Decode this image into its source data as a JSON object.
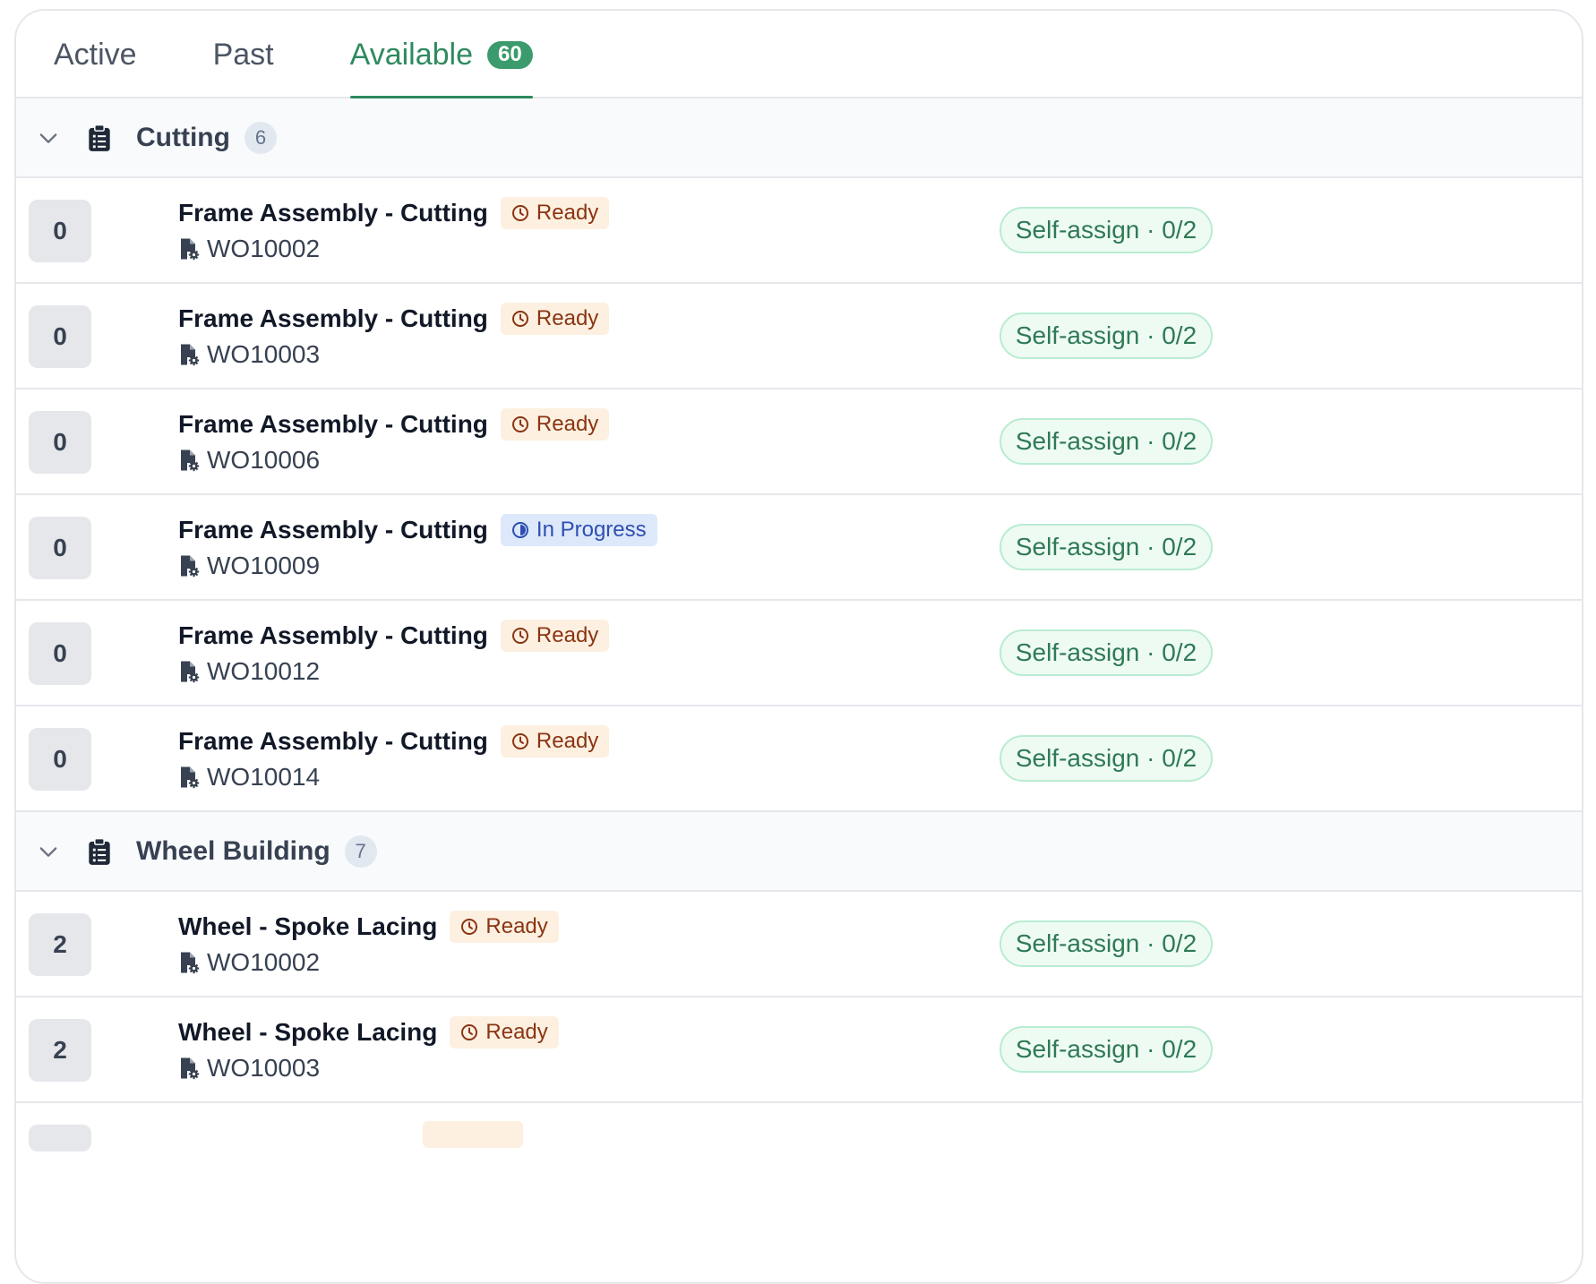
{
  "tabs": [
    {
      "label": "Active"
    },
    {
      "label": "Past"
    },
    {
      "label": "Available",
      "count": "60"
    }
  ],
  "groups": [
    {
      "name": "Cutting",
      "count": "6",
      "rows": [
        {
          "qty": "0",
          "title": "Frame Assembly - Cutting",
          "status": "Ready",
          "wo": "WO10002",
          "action": "Self-assign · 0/2"
        },
        {
          "qty": "0",
          "title": "Frame Assembly - Cutting",
          "status": "Ready",
          "wo": "WO10003",
          "action": "Self-assign · 0/2"
        },
        {
          "qty": "0",
          "title": "Frame Assembly - Cutting",
          "status": "Ready",
          "wo": "WO10006",
          "action": "Self-assign · 0/2"
        },
        {
          "qty": "0",
          "title": "Frame Assembly - Cutting",
          "status": "In Progress",
          "wo": "WO10009",
          "action": "Self-assign · 0/2"
        },
        {
          "qty": "0",
          "title": "Frame Assembly - Cutting",
          "status": "Ready",
          "wo": "WO10012",
          "action": "Self-assign · 0/2"
        },
        {
          "qty": "0",
          "title": "Frame Assembly - Cutting",
          "status": "Ready",
          "wo": "WO10014",
          "action": "Self-assign · 0/2"
        }
      ]
    },
    {
      "name": "Wheel Building",
      "count": "7",
      "rows": [
        {
          "qty": "2",
          "title": "Wheel - Spoke Lacing",
          "status": "Ready",
          "wo": "WO10002",
          "action": "Self-assign · 0/2"
        },
        {
          "qty": "2",
          "title": "Wheel - Spoke Lacing",
          "status": "Ready",
          "wo": "WO10003",
          "action": "Self-assign · 0/2"
        }
      ]
    }
  ],
  "icons": {
    "chevron": "chevron-down-icon",
    "group": "clipboard-list-icon",
    "status_ready": "clock-icon",
    "status_in_progress": "half-circle-icon",
    "work_order": "file-gear-icon"
  },
  "colors": {
    "accent_green": "#2f8a5e",
    "ready_bg": "#fdf0e1",
    "ready_text": "#8a3512",
    "in_progress_bg": "#dde8fb",
    "in_progress_text": "#2e4fb0",
    "assign_bg": "#eefbf3",
    "assign_border": "#b9ecd1"
  }
}
